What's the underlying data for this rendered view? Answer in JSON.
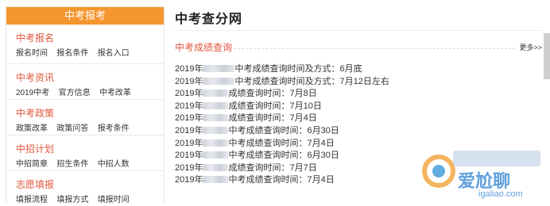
{
  "sidebar": {
    "header": "中考报考",
    "sections": [
      {
        "title": "中考报名",
        "links": [
          "报名时间",
          "报名条件",
          "报名入口"
        ]
      },
      {
        "title": "中考资讯",
        "links": [
          "2019中考",
          "官方信息",
          "中考改革"
        ]
      },
      {
        "title": "中考政策",
        "links": [
          "政策改革",
          "政策问答",
          "报考条件"
        ]
      },
      {
        "title": "中招计划",
        "links": [
          "中招简章",
          "招生条件",
          "中招人数"
        ]
      },
      {
        "title": "志愿填报",
        "links": [
          "填报流程",
          "填报方式",
          "填报时间"
        ]
      }
    ]
  },
  "main": {
    "title": "中考查分网",
    "section_title": "中考成绩查询",
    "more": "更多>>",
    "items": [
      {
        "pre": "2019年",
        "post": "中考成绩查询时间及方式：6月底"
      },
      {
        "pre": "2019年",
        "post": "中考成绩查询时间及方式：7月12日左右"
      },
      {
        "pre": "2019年",
        "post": "成绩查询时间：7月8日"
      },
      {
        "pre": "2019年",
        "post": "成绩查询时间：7月10日"
      },
      {
        "pre": "2019年",
        "post": "成绩查询时间：7月4日"
      },
      {
        "pre": "2019年",
        "post": "中考成绩查询时间：6月30日"
      },
      {
        "pre": "2019年",
        "post": "中考成绩查询时间：7月4日"
      },
      {
        "pre": "2019年",
        "post": "中考成绩查询时间：6月30日"
      },
      {
        "pre": "2019年",
        "post": "成绩查询时间：7月7日"
      },
      {
        "pre": "2019年",
        "post": "中考成绩查询时间：7月4日"
      }
    ]
  },
  "watermark": {
    "text": "爱尬聊",
    "url": "igaliao.com"
  },
  "colors": {
    "accent": "#f5962e",
    "red": "#e0573d"
  }
}
